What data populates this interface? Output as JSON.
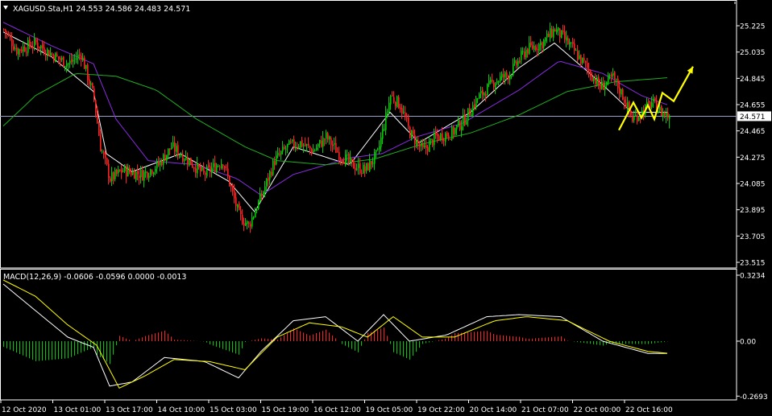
{
  "window": {
    "symbol_line": "XAGUSD.Sta,H1  24.553 24.586 24.483 24.571",
    "macd_line": "MACD(12,26,9) -0.0606 -0.0596 0.0000 -0.0013"
  },
  "colors": {
    "background": "#000000",
    "frame": "#ffffff",
    "bull": "#00cc00",
    "bear": "#ff2020",
    "ma_fast": "#ffffff",
    "ma_mid": "#8a2be2",
    "ma_slow": "#20b020",
    "bid_line": "#9aa0c8",
    "forecast": "#ffff00",
    "macd_main": "#ffffff",
    "macd_signal": "#ffff00"
  },
  "chart_data": [
    {
      "type": "candlestick",
      "title": "XAGUSD.Sta,H1",
      "ohlc_header": {
        "open": 24.553,
        "high": 24.586,
        "low": 24.483,
        "close": 24.571
      },
      "ylim": [
        23.515,
        25.415
      ],
      "y_ticks": [
        "25.225",
        "25.035",
        "24.845",
        "24.655",
        "24.465",
        "24.275",
        "24.085",
        "23.895",
        "23.705",
        "23.515"
      ],
      "current_price": "24.571",
      "x_ticks": [
        "12 Oct 2020",
        "13 Oct 01:00",
        "13 Oct 17:00",
        "14 Oct 10:00",
        "15 Oct 03:00",
        "15 Oct 19:00",
        "16 Oct 12:00",
        "19 Oct 05:00",
        "19 Oct 22:00",
        "20 Oct 14:00",
        "21 Oct 07:00",
        "22 Oct 00:00",
        "22 Oct 16:00"
      ],
      "close_path_keypoints": [
        [
          0,
          25.2
        ],
        [
          8,
          25.05
        ],
        [
          20,
          25.1
        ],
        [
          32,
          25.0
        ],
        [
          40,
          24.95
        ],
        [
          48,
          25.02
        ],
        [
          56,
          24.7
        ],
        [
          60,
          24.35
        ],
        [
          66,
          24.12
        ],
        [
          74,
          24.18
        ],
        [
          86,
          24.15
        ],
        [
          96,
          24.22
        ],
        [
          104,
          24.35
        ],
        [
          112,
          24.28
        ],
        [
          124,
          24.15
        ],
        [
          136,
          24.25
        ],
        [
          146,
          23.85
        ],
        [
          152,
          23.78
        ],
        [
          160,
          24.0
        ],
        [
          168,
          24.25
        ],
        [
          176,
          24.35
        ],
        [
          184,
          24.38
        ],
        [
          192,
          24.32
        ],
        [
          200,
          24.42
        ],
        [
          208,
          24.3
        ],
        [
          216,
          24.22
        ],
        [
          224,
          24.18
        ],
        [
          232,
          24.3
        ],
        [
          240,
          24.72
        ],
        [
          246,
          24.65
        ],
        [
          252,
          24.45
        ],
        [
          260,
          24.32
        ],
        [
          268,
          24.42
        ],
        [
          278,
          24.45
        ],
        [
          286,
          24.55
        ],
        [
          294,
          24.7
        ],
        [
          304,
          24.82
        ],
        [
          314,
          24.88
        ],
        [
          324,
          25.05
        ],
        [
          334,
          25.1
        ],
        [
          342,
          25.2
        ],
        [
          350,
          25.1
        ],
        [
          360,
          24.95
        ],
        [
          370,
          24.78
        ],
        [
          378,
          24.85
        ],
        [
          384,
          24.72
        ],
        [
          390,
          24.55
        ],
        [
          396,
          24.6
        ],
        [
          402,
          24.67
        ],
        [
          408,
          24.6
        ],
        [
          413,
          24.57
        ]
      ],
      "moving_averages": [
        {
          "name": "",
          "color": "ma_fast",
          "keypoints": [
            [
              0,
              25.18
            ],
            [
              30,
              25.0
            ],
            [
              56,
              24.75
            ],
            [
              64,
              24.3
            ],
            [
              80,
              24.17
            ],
            [
              110,
              24.3
            ],
            [
              140,
              24.1
            ],
            [
              156,
              23.88
            ],
            [
              180,
              24.35
            ],
            [
              215,
              24.22
            ],
            [
              240,
              24.6
            ],
            [
              258,
              24.38
            ],
            [
              290,
              24.6
            ],
            [
              320,
              24.92
            ],
            [
              342,
              25.1
            ],
            [
              370,
              24.82
            ],
            [
              390,
              24.6
            ],
            [
              413,
              24.6
            ]
          ]
        },
        {
          "name": "",
          "color": "ma_mid",
          "keypoints": [
            [
              0,
              25.25
            ],
            [
              30,
              25.08
            ],
            [
              56,
              24.95
            ],
            [
              70,
              24.55
            ],
            [
              90,
              24.25
            ],
            [
              120,
              24.22
            ],
            [
              145,
              24.12
            ],
            [
              160,
              24.0
            ],
            [
              180,
              24.15
            ],
            [
              215,
              24.27
            ],
            [
              235,
              24.3
            ],
            [
              256,
              24.42
            ],
            [
              285,
              24.52
            ],
            [
              320,
              24.76
            ],
            [
              345,
              24.97
            ],
            [
              372,
              24.88
            ],
            [
              396,
              24.72
            ],
            [
              413,
              24.65
            ]
          ]
        },
        {
          "name": "",
          "color": "ma_slow",
          "keypoints": [
            [
              0,
              24.5
            ],
            [
              20,
              24.72
            ],
            [
              45,
              24.88
            ],
            [
              70,
              24.86
            ],
            [
              95,
              24.76
            ],
            [
              120,
              24.55
            ],
            [
              150,
              24.35
            ],
            [
              170,
              24.25
            ],
            [
              200,
              24.22
            ],
            [
              230,
              24.26
            ],
            [
              260,
              24.37
            ],
            [
              290,
              24.45
            ],
            [
              320,
              24.58
            ],
            [
              350,
              24.75
            ],
            [
              380,
              24.82
            ],
            [
              413,
              24.85
            ]
          ]
        }
      ],
      "forecast_zigzag": [
        [
          382,
          24.47
        ],
        [
          391,
          24.67
        ],
        [
          396,
          24.56
        ],
        [
          400,
          24.65
        ],
        [
          404,
          24.55
        ],
        [
          409,
          24.74
        ],
        [
          416,
          24.68
        ],
        [
          428,
          24.93
        ]
      ]
    },
    {
      "type": "macd",
      "title": "MACD(12,26,9)",
      "params": [
        12,
        26,
        9
      ],
      "values_header": {
        "main": -0.0606,
        "signal": -0.0596,
        "histogram": 0.0,
        "extra": -0.0013
      },
      "ylim": [
        -0.2693,
        0.3234
      ],
      "y_ticks": [
        "0.3234",
        "0.00",
        "-0.2693"
      ],
      "main_keypoints": [
        [
          0,
          0.28
        ],
        [
          20,
          0.15
        ],
        [
          40,
          0.02
        ],
        [
          56,
          -0.03
        ],
        [
          66,
          -0.22
        ],
        [
          80,
          -0.2
        ],
        [
          100,
          -0.08
        ],
        [
          125,
          -0.1
        ],
        [
          146,
          -0.18
        ],
        [
          160,
          -0.05
        ],
        [
          180,
          0.1
        ],
        [
          200,
          0.12
        ],
        [
          220,
          0.0
        ],
        [
          236,
          0.13
        ],
        [
          252,
          0.0
        ],
        [
          275,
          0.03
        ],
        [
          300,
          0.12
        ],
        [
          320,
          0.13
        ],
        [
          346,
          0.12
        ],
        [
          372,
          0.0
        ],
        [
          400,
          -0.06
        ],
        [
          413,
          -0.06
        ]
      ],
      "signal_keypoints": [
        [
          0,
          0.3
        ],
        [
          20,
          0.22
        ],
        [
          40,
          0.08
        ],
        [
          58,
          -0.02
        ],
        [
          72,
          -0.23
        ],
        [
          88,
          -0.17
        ],
        [
          106,
          -0.09
        ],
        [
          128,
          -0.1
        ],
        [
          150,
          -0.14
        ],
        [
          170,
          0.02
        ],
        [
          190,
          0.09
        ],
        [
          210,
          0.07
        ],
        [
          226,
          0.02
        ],
        [
          242,
          0.12
        ],
        [
          260,
          0.02
        ],
        [
          280,
          0.02
        ],
        [
          305,
          0.1
        ],
        [
          325,
          0.12
        ],
        [
          350,
          0.1
        ],
        [
          376,
          0.0
        ],
        [
          400,
          -0.05
        ],
        [
          413,
          -0.06
        ]
      ]
    }
  ]
}
